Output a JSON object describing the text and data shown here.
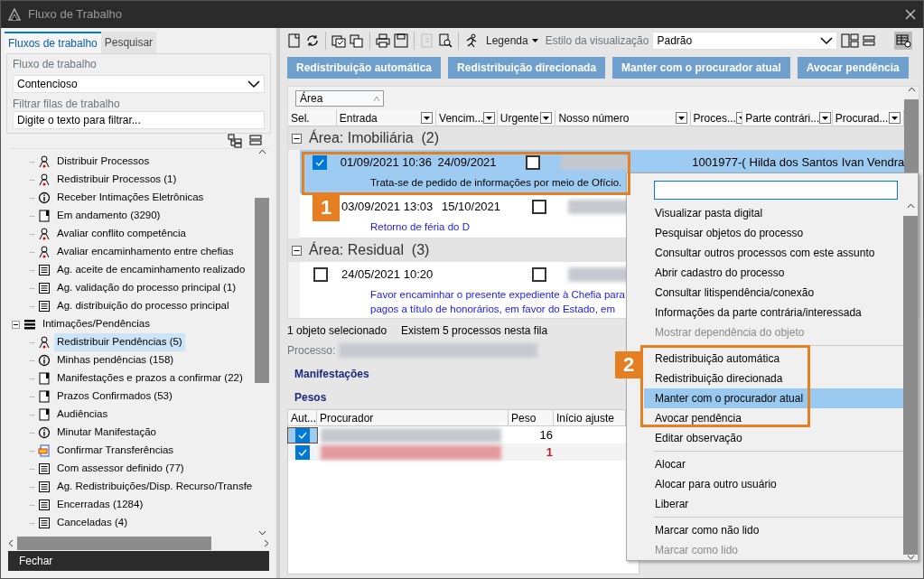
{
  "window": {
    "title": "Fluxo de Trabalho"
  },
  "left_panel": {
    "tabs": [
      {
        "label": "Fluxos de trabalho",
        "selected": true
      },
      {
        "label": "Pesquisar",
        "selected": false
      }
    ],
    "workflow_label": "Fluxo de trabalho",
    "workflow_value": "Contencioso",
    "filter_label": "Filtrar filas de trabalho",
    "filter_value": "Digite o texto para filtrar...",
    "tree": [
      {
        "children": [
          {
            "label": "Distribuir Processos",
            "kind": "person",
            "selected": false
          },
          {
            "label": "Redistribuir Processos (1)",
            "kind": "person",
            "selected": false
          },
          {
            "label": "Receber Intimações Eletrônicas",
            "kind": "info",
            "selected": false
          },
          {
            "label": "Em andamento (3290)",
            "kind": "doc",
            "selected": false
          },
          {
            "label": "Avaliar conflito competência",
            "kind": "person",
            "selected": false
          },
          {
            "label": "Avaliar encaminhamento entre chefias",
            "kind": "person",
            "selected": false
          },
          {
            "label": "Ag. aceite de encaminhamento realizado",
            "kind": "form",
            "selected": false
          },
          {
            "label": "Ag. validação do processo principal (1)",
            "kind": "form",
            "selected": false
          },
          {
            "label": "Ag. distribuição do processo principal",
            "kind": "form",
            "selected": false
          }
        ]
      },
      {
        "label": "Intimações/Pendências",
        "kind": "list",
        "expanded": true,
        "selected": false,
        "children": [
          {
            "label": "Redistribuir Pendências (5)",
            "kind": "person",
            "selected": true
          },
          {
            "label": "Minhas pendências (158)",
            "kind": "info",
            "selected": false
          },
          {
            "label": "Manifestações e prazos a confirmar (22)",
            "kind": "doc",
            "selected": false
          },
          {
            "label": "Prazos Confirmados (53)",
            "kind": "doc",
            "selected": false
          },
          {
            "label": "Audiências",
            "kind": "doc",
            "selected": false
          },
          {
            "label": "Minutar Manifestação",
            "kind": "info",
            "selected": false
          },
          {
            "label": "Confirmar Transferências",
            "kind": "transfer",
            "selected": false
          },
          {
            "label": "Com assessor definido (77)",
            "kind": "form",
            "selected": false
          },
          {
            "label": "Ag. Redistribuições/Disp. Recurso/Transfe",
            "kind": "form",
            "selected": false
          },
          {
            "label": "Encerradas (1284)",
            "kind": "form",
            "selected": false
          },
          {
            "label": "Canceladas (4)",
            "kind": "form",
            "selected": false
          }
        ]
      }
    ],
    "close_button": "Fechar"
  },
  "toolbar": {
    "legend": "Legenda",
    "style_label": "Estilo da visualização",
    "style_value": "Padrão"
  },
  "actions": [
    "Redistribuição automática",
    "Redistribuição direcionada",
    "Manter com o procurador atual",
    "Avocar pendência"
  ],
  "grid": {
    "group_by": "Área",
    "columns": [
      "Sel.",
      "Entrada",
      "Vencim...",
      "Urgente",
      "Nosso número",
      "Proces...",
      "Parte contrári...",
      "Procurad..."
    ],
    "groups": [
      {
        "title": "Área: Imobiliária",
        "count": "(2)",
        "expanded": true,
        "rows": [
          {
            "checked": true,
            "selected": true,
            "entrada": "01/09/2021 10:36",
            "vencimento": "24/09/2021",
            "urgent": false,
            "processo": "1001977-(",
            "parte": "Hilda dos Santos",
            "procurador": "Ivan Vendra",
            "note": [
              "Trata-se de pedido de informações por meio de Ofício."
            ]
          },
          {
            "selected": false,
            "entrada": "03/09/2021 13:03",
            "vencimento": "15/10/2021",
            "urgent": false,
            "note": [
              "Retorno de féria do D"
            ]
          }
        ]
      },
      {
        "title": "Área: Residual",
        "count": "(3)",
        "expanded": true,
        "rows": [
          {
            "checked": false,
            "selected": false,
            "entrada": "24/05/2021 10:20",
            "urgent": false,
            "note": [
              "Favor encaminhar o presente expediente à Chefia para",
              "pagos a título de honorários, em favor do Estado, em"
            ]
          }
        ]
      }
    ]
  },
  "status": [
    "1 objeto selecionado",
    "Existem 5 processos nesta fila"
  ],
  "process_label": "Processo:",
  "links": [
    "Manifestações",
    "Pesos"
  ],
  "weights": {
    "columns": [
      "Aut...",
      "Procurador",
      "Peso",
      "Início ajuste"
    ],
    "rows": [
      {
        "auto": true,
        "selected": true,
        "peso": "16",
        "color": "#000000"
      },
      {
        "auto": true,
        "selected": false,
        "peso": "1",
        "color": "#c0202a"
      }
    ]
  },
  "context_menu": {
    "groups": [
      [
        {
          "label": "Visualizar pasta digital",
          "disabled": false,
          "selected": false
        },
        {
          "label": "Pesquisar objetos do processo",
          "disabled": false,
          "selected": false
        },
        {
          "label": "Consultar outros processos com este assunto",
          "disabled": false,
          "selected": false
        },
        {
          "label": "Abrir cadastro do processo",
          "disabled": false,
          "selected": false
        },
        {
          "label": "Consultar litispendência/conexão",
          "disabled": false,
          "selected": false
        },
        {
          "label": "Informações da parte contrária/interessada",
          "disabled": false,
          "selected": false
        },
        {
          "label": "Mostrar dependência do objeto",
          "disabled": true,
          "selected": false
        }
      ],
      [
        {
          "label": "Redistribuição automática",
          "disabled": false,
          "selected": false
        },
        {
          "label": "Redistribuição direcionada",
          "disabled": false,
          "selected": false
        },
        {
          "label": "Manter com o procurador atual",
          "disabled": false,
          "selected": true
        },
        {
          "label": "Avocar pendência",
          "disabled": false,
          "selected": false
        },
        {
          "label": "Editar observação",
          "disabled": false,
          "selected": false
        }
      ],
      [
        {
          "label": "Alocar",
          "disabled": false,
          "selected": false
        },
        {
          "label": "Alocar para outro usuário",
          "disabled": false,
          "selected": false
        },
        {
          "label": "Liberar",
          "disabled": false,
          "selected": false
        }
      ],
      [
        {
          "label": "Marcar como não lido",
          "disabled": false,
          "selected": false
        },
        {
          "label": "Marcar como lido",
          "disabled": true,
          "selected": false
        }
      ]
    ]
  },
  "callouts": [
    {
      "label": "1",
      "kind": "row"
    },
    {
      "label": "2",
      "kind": "menu"
    }
  ]
}
